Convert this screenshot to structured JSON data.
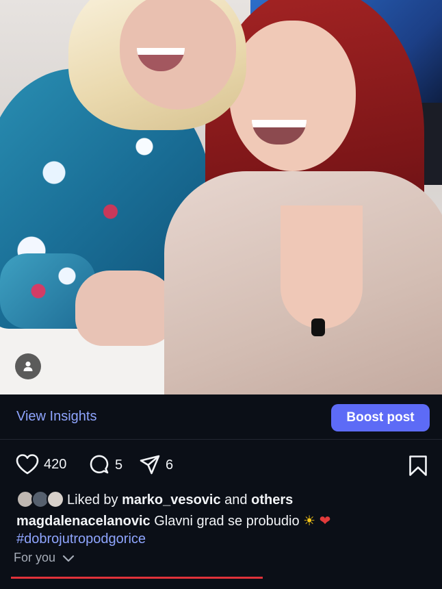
{
  "photo": {
    "subject": "post-image",
    "avatar_icon": "person-icon"
  },
  "insights": {
    "view_label": "View Insights",
    "boost_label": "Boost post"
  },
  "actions": {
    "likes": "420",
    "comments": "5",
    "shares": "6",
    "icons": [
      "heart-icon",
      "comment-icon",
      "share-icon",
      "bookmark-icon"
    ]
  },
  "liked_by": {
    "prefix": "Liked by",
    "user": "marko_vesovic",
    "connector": "and",
    "others": "others"
  },
  "caption": {
    "user": "magdalenacelanovic",
    "text": "Glavni grad se probudio",
    "emoji_sun": "☀",
    "emoji_heart": "❤",
    "hashtag": "#dobrojutropodgorice"
  },
  "feed": {
    "label": "For you"
  },
  "playback": {
    "progress": 0.6
  },
  "colors": {
    "background": "#0b0f17",
    "accent": "#5d6bf6",
    "link": "#8fa5ff",
    "progress": "#e0323a"
  }
}
